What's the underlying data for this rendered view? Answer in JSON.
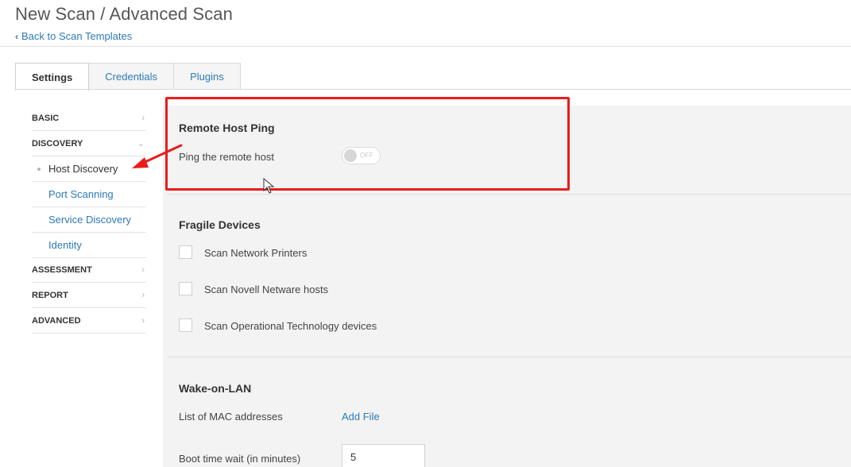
{
  "header": {
    "title": "New Scan / Advanced Scan",
    "back_link": "Back to Scan Templates"
  },
  "tabs": [
    {
      "label": "Settings",
      "active": true
    },
    {
      "label": "Credentials",
      "active": false
    },
    {
      "label": "Plugins",
      "active": false
    }
  ],
  "sidebar": {
    "basic": "BASIC",
    "discovery": "DISCOVERY",
    "discovery_items": [
      "Host Discovery",
      "Port Scanning",
      "Service Discovery",
      "Identity"
    ],
    "assessment": "ASSESSMENT",
    "report": "REPORT",
    "advanced": "ADVANCED"
  },
  "remote_host_ping": {
    "title": "Remote Host Ping",
    "ping_label": "Ping the remote host",
    "toggle_state": "OFF"
  },
  "fragile_devices": {
    "title": "Fragile Devices",
    "options": [
      {
        "label": "Scan Network Printers",
        "checked": false
      },
      {
        "label": "Scan Novell Netware hosts",
        "checked": false
      },
      {
        "label": "Scan Operational Technology devices",
        "checked": false
      }
    ]
  },
  "wake_on_lan": {
    "title": "Wake-on-LAN",
    "mac_label": "List of MAC addresses",
    "add_file": "Add File",
    "boot_label": "Boot time wait (in minutes)",
    "boot_value": "5"
  },
  "colors": {
    "link": "#2d7ab8",
    "highlight": "#ea1c1c"
  }
}
